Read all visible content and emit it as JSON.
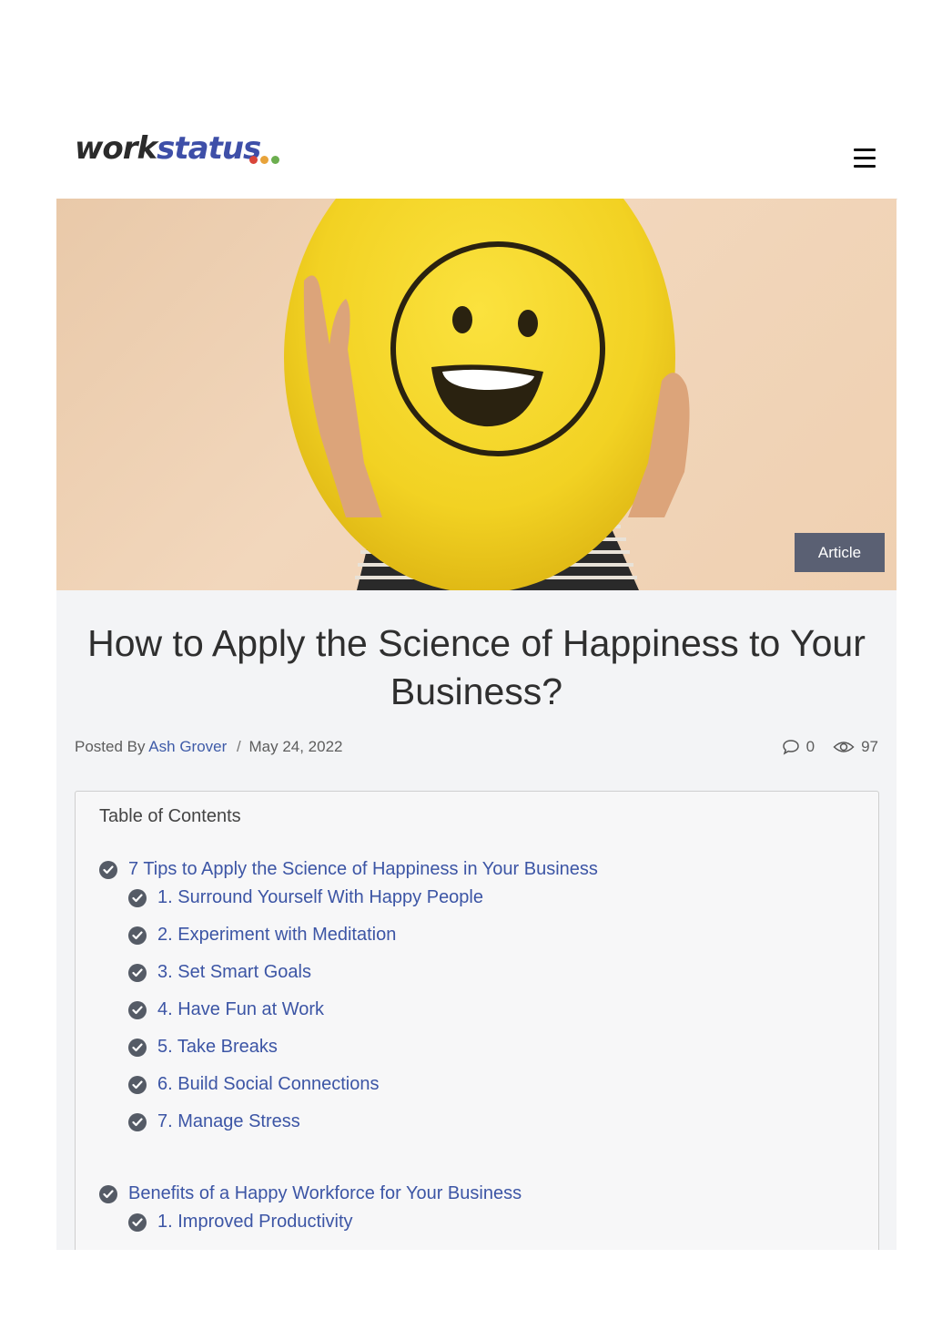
{
  "header": {
    "logo_part1": "work",
    "logo_part2": "status",
    "logo_dots": [
      "#d9453a",
      "#e8a33a",
      "#6cae4f"
    ],
    "menu_icon": "hamburger-menu-icon"
  },
  "hero": {
    "badge": "Article",
    "image": "smiley-balloon-photo"
  },
  "article": {
    "title": "How to Apply the Science of Happiness to Your Business?",
    "posted_by_label": "Posted By",
    "author": "Ash Grover",
    "separator": "/",
    "date": "May 24, 2022",
    "comments": "0",
    "views": "97"
  },
  "toc": {
    "title": "Table of Contents",
    "sections": [
      {
        "label": "7 Tips to Apply the Science of Happiness in Your Business",
        "items": [
          "1. Surround Yourself With Happy People",
          "2. Experiment with Meditation",
          "3. Set Smart Goals",
          "4. Have Fun at Work",
          "5. Take Breaks",
          "6. Build Social Connections",
          "7. Manage Stress"
        ]
      },
      {
        "label": "Benefits of a Happy Workforce for Your Business",
        "items": [
          "1. Improved Productivity"
        ]
      }
    ]
  },
  "colors": {
    "link": "#3c55a5",
    "badge_bg": "#5a6073",
    "card_bg": "#f3f4f6",
    "balloon": "#f3d62a"
  }
}
